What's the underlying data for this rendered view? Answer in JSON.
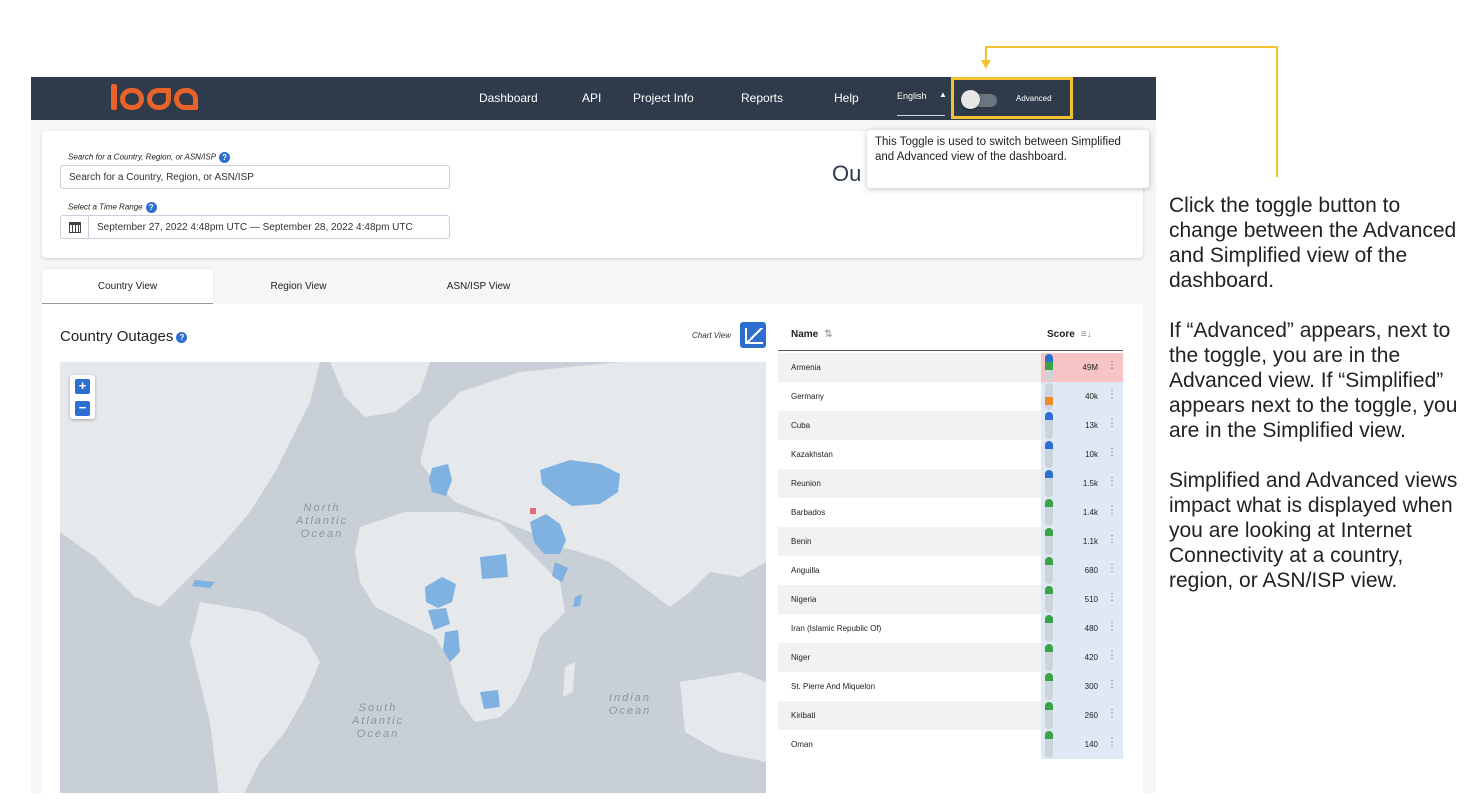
{
  "navbar": {
    "links": [
      "Dashboard",
      "API",
      "Project Info",
      "Reports",
      "Help"
    ],
    "language": "English",
    "toggle_label": "Advanced"
  },
  "tooltip": "This Toggle is used to switch between Simplified and Advanced view of the dashboard.",
  "search": {
    "label": "Search for a Country, Region, or ASN/ISP",
    "placeholder": "Search for a Country, Region, or ASN/ISP",
    "time_label": "Select a Time Range",
    "time_value": "September 27, 2022 4:48pm UTC — September 28, 2022 4:48pm UTC"
  },
  "page_title_partial": "Ou",
  "tabs": [
    "Country View",
    "Region View",
    "ASN/ISP View"
  ],
  "card": {
    "title": "Country Outages",
    "chart_view_label": "Chart View"
  },
  "map": {
    "zoom_in": "+",
    "zoom_out": "−",
    "oceans": [
      "North Atlantic Ocean",
      "South Atlantic Ocean",
      "Indian Ocean"
    ]
  },
  "table": {
    "col_name": "Name",
    "col_score": "Score",
    "rows": [
      {
        "name": "Armenia",
        "score": "49M",
        "bar": [
          "#2d6fd1",
          "#3aa345"
        ]
      },
      {
        "name": "Germany",
        "score": "40k",
        "bar": [
          "#f08c2e"
        ]
      },
      {
        "name": "Cuba",
        "score": "13k",
        "bar": [
          "#2d6fd1"
        ]
      },
      {
        "name": "Kazakhstan",
        "score": "10k",
        "bar": [
          "#2d6fd1"
        ]
      },
      {
        "name": "Reunion",
        "score": "1.5k",
        "bar": [
          "#2d6fd1"
        ]
      },
      {
        "name": "Barbados",
        "score": "1.4k",
        "bar": [
          "#3aa345"
        ]
      },
      {
        "name": "Benin",
        "score": "1.1k",
        "bar": [
          "#3aa345"
        ]
      },
      {
        "name": "Anguilla",
        "score": "680",
        "bar": [
          "#3aa345"
        ]
      },
      {
        "name": "Nigeria",
        "score": "510",
        "bar": [
          "#3aa345"
        ]
      },
      {
        "name": "Iran (Islamic Republic Of)",
        "score": "480",
        "bar": [
          "#3aa345"
        ]
      },
      {
        "name": "Niger",
        "score": "420",
        "bar": [
          "#3aa345"
        ]
      },
      {
        "name": "St. Pierre And Miquelon",
        "score": "300",
        "bar": [
          "#3aa345"
        ]
      },
      {
        "name": "Kiribati",
        "score": "260",
        "bar": [
          "#3aa345"
        ]
      },
      {
        "name": "Oman",
        "score": "140",
        "bar": [
          "#3aa345"
        ]
      }
    ]
  },
  "annotation": {
    "p1": "Click the toggle button to change between the Advanced and Simplified view of the dashboard.",
    "p2": "If “Advanced” appears, next to the toggle, you are in the Advanced view. If “Simplified” appears next to the toggle, you are in the Simplified view.",
    "p3": "Simplified and Advanced views impact what is displayed when you are looking at Internet Connectivity at a country, region, or ASN/ISP view."
  },
  "colors": {
    "navbar": "#2f3b4a",
    "logo": "#e8622a",
    "highlight": "#f2c230",
    "accent": "#2d6fd1",
    "outage_fill": "#7fb2e0"
  }
}
